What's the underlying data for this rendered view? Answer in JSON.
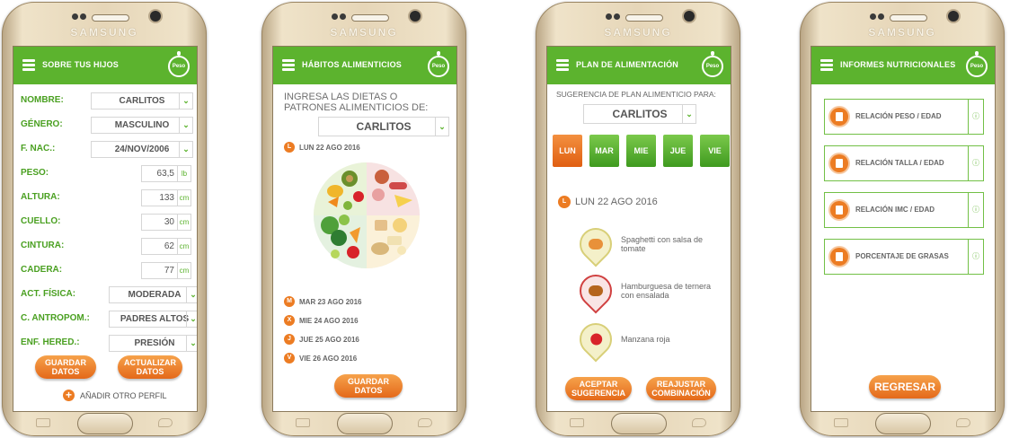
{
  "device_brand": "SAMSUNG",
  "logo_text": "Peso",
  "colors": {
    "green": "#5cb32e",
    "orange": "#ec7c23"
  },
  "screen1": {
    "title": "SOBRE TUS HIJOS",
    "fields": [
      {
        "label": "NOMBRE:",
        "value": "CARLITOS"
      },
      {
        "label": "GÉNERO:",
        "value": "MASCULINO"
      },
      {
        "label": "F. NAC.:",
        "value": "24/NOV/2006"
      },
      {
        "label": "PESO:",
        "value": "63,5",
        "unit": "lb"
      },
      {
        "label": "ALTURA:",
        "value": "133",
        "unit": "cm"
      },
      {
        "label": "CUELLO:",
        "value": "30",
        "unit": "cm"
      },
      {
        "label": "CINTURA:",
        "value": "62",
        "unit": "cm"
      },
      {
        "label": "CADERA:",
        "value": "77",
        "unit": "cm"
      },
      {
        "label": "ACT. FÍSICA:",
        "value": "MODERADA"
      },
      {
        "label": "C. ANTROPOM.:",
        "value": "PADRES ALTOS"
      },
      {
        "label": "ENF. HERED.:",
        "value": "PRESIÓN"
      }
    ],
    "save_label": "GUARDAR DATOS",
    "update_label": "ACTUALIZAR DATOS",
    "add_profile_label": "AÑADIR OTRO PERFIL"
  },
  "screen2": {
    "title": "HÁBITOS ALIMENTICIOS",
    "prompt": "INGRESA LAS DIETAS O PATRONES ALIMENTICIOS DE:",
    "selected_child": "CARLITOS",
    "days": [
      {
        "badge": "L",
        "label": "LUN 22 AGO 2016"
      },
      {
        "badge": "M",
        "label": "MAR 23 AGO 2016"
      },
      {
        "badge": "X",
        "label": "MIE 24 AGO 2016"
      },
      {
        "badge": "J",
        "label": "JUE 25 AGO 2016"
      },
      {
        "badge": "V",
        "label": "VIE 26 AGO 2016"
      }
    ],
    "save_label": "GUARDAR DATOS"
  },
  "screen3": {
    "title": "PLAN DE ALIMENTACIÓN",
    "suggestion_label": "SUGERENCIA DE PLAN ALIMENTICIO PARA:",
    "selected_child": "CARLITOS",
    "day_tabs": [
      "LUN",
      "MAR",
      "MIE",
      "JUE",
      "VIE"
    ],
    "active_day": "LUN",
    "day_badge": "L",
    "current_date": "LUN 22 AGO 2016",
    "meals": [
      "Spaghetti con salsa de tomate",
      "Hamburguesa de ternera con ensalada",
      "Manzana roja"
    ],
    "accept_label": "ACEPTAR SUGERENCIA",
    "readjust_label": "REAJUSTAR COMBINACIÓN"
  },
  "screen4": {
    "title": "INFORMES NUTRICIONALES",
    "reports": [
      "RELACIÓN PESO / EDAD",
      "RELACIÓN TALLA / EDAD",
      "RELACIÓN IMC / EDAD",
      "PORCENTAJE DE GRASAS"
    ],
    "info_glyph": "ⓘ",
    "back_label": "REGRESAR"
  }
}
